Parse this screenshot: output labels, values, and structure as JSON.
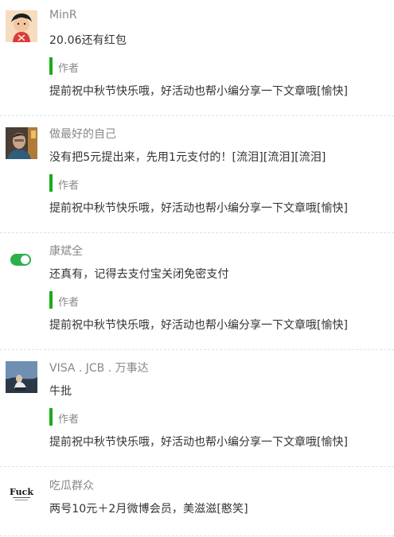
{
  "comments": [
    {
      "nick": "MinR",
      "content": "20.06还有红包",
      "avatar_icon": "cartoon-avatar-icon",
      "reply": {
        "label": "作者",
        "content": "提前祝中秋节快乐哦，好活动也帮小编分享一下文章哦[愉快]"
      }
    },
    {
      "nick": "做最好的自己",
      "content": "没有把5元提出来，先用1元支付的！[流泪][流泪][流泪]",
      "avatar_icon": "photo-avatar-icon",
      "reply": {
        "label": "作者",
        "content": "提前祝中秋节快乐哦，好活动也帮小编分享一下文章哦[愉快]"
      }
    },
    {
      "nick": "康斌全",
      "content": "还真有，记得去支付宝关闭免密支付",
      "avatar_icon": "toggle-avatar-icon",
      "reply": {
        "label": "作者",
        "content": "提前祝中秋节快乐哦，好活动也帮小编分享一下文章哦[愉快]"
      }
    },
    {
      "nick": "VISA . JCB . 万事达",
      "content": "牛批",
      "avatar_icon": "landscape-avatar-icon",
      "reply": {
        "label": "作者",
        "content": "提前祝中秋节快乐哦，好活动也帮小编分享一下文章哦[愉快]"
      }
    },
    {
      "nick": "吃瓜群众",
      "content": "两号10元＋2月微博会员，美滋滋[憨笑]",
      "avatar_icon": "text-logo-avatar-icon",
      "avatar_text": "Fuck"
    }
  ],
  "colors": {
    "accent_green": "#1aad19",
    "nick_gray": "#888888",
    "text_dark": "#333333"
  }
}
